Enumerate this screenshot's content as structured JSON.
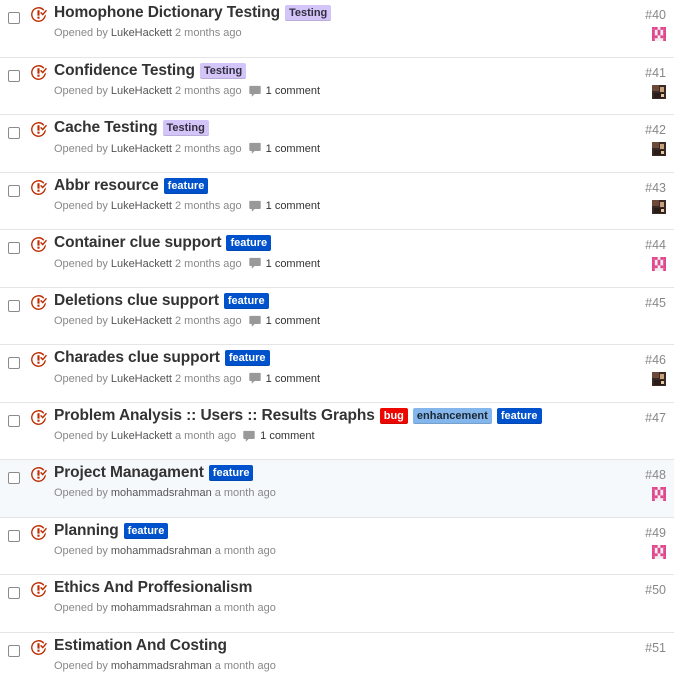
{
  "issues": [
    {
      "title": "Homophone Dictionary Testing",
      "labels": [
        {
          "text": "Testing",
          "cls": "testing"
        }
      ],
      "opened_by_prefix": "Opened by",
      "author": "LukeHackett",
      "time": "2 months ago",
      "comments": "",
      "number": "#40",
      "avatar": "identicon-pink",
      "highlighted": false
    },
    {
      "title": "Confidence Testing",
      "labels": [
        {
          "text": "Testing",
          "cls": "testing"
        }
      ],
      "opened_by_prefix": "Opened by",
      "author": "LukeHackett",
      "time": "2 months ago",
      "comments": "1 comment",
      "number": "#41",
      "avatar": "photo-dark",
      "highlighted": false
    },
    {
      "title": "Cache Testing",
      "labels": [
        {
          "text": "Testing",
          "cls": "testing"
        }
      ],
      "opened_by_prefix": "Opened by",
      "author": "LukeHackett",
      "time": "2 months ago",
      "comments": "1 comment",
      "number": "#42",
      "avatar": "photo-dark",
      "highlighted": false
    },
    {
      "title": "Abbr resource",
      "labels": [
        {
          "text": "feature",
          "cls": "feature"
        }
      ],
      "opened_by_prefix": "Opened by",
      "author": "LukeHackett",
      "time": "2 months ago",
      "comments": "1 comment",
      "number": "#43",
      "avatar": "photo-dark",
      "highlighted": false
    },
    {
      "title": "Container clue support",
      "labels": [
        {
          "text": "feature",
          "cls": "feature"
        }
      ],
      "opened_by_prefix": "Opened by",
      "author": "LukeHackett",
      "time": "2 months ago",
      "comments": "1 comment",
      "number": "#44",
      "avatar": "identicon-pink",
      "highlighted": false
    },
    {
      "title": "Deletions clue support",
      "labels": [
        {
          "text": "feature",
          "cls": "feature"
        }
      ],
      "opened_by_prefix": "Opened by",
      "author": "LukeHackett",
      "time": "2 months ago",
      "comments": "1 comment",
      "number": "#45",
      "avatar": "",
      "highlighted": false
    },
    {
      "title": "Charades clue support",
      "labels": [
        {
          "text": "feature",
          "cls": "feature"
        }
      ],
      "opened_by_prefix": "Opened by",
      "author": "LukeHackett",
      "time": "2 months ago",
      "comments": "1 comment",
      "number": "#46",
      "avatar": "photo-dark",
      "highlighted": false
    },
    {
      "title": "Problem Analysis :: Users :: Results Graphs",
      "labels": [
        {
          "text": "bug",
          "cls": "bug"
        },
        {
          "text": "enhancement",
          "cls": "enhancement"
        },
        {
          "text": "feature",
          "cls": "feature"
        }
      ],
      "opened_by_prefix": "Opened by",
      "author": "LukeHackett",
      "time": "a month ago",
      "comments": "1 comment",
      "number": "#47",
      "avatar": "",
      "highlighted": false
    },
    {
      "title": "Project Managament",
      "labels": [
        {
          "text": "feature",
          "cls": "feature"
        }
      ],
      "opened_by_prefix": "Opened by",
      "author": "mohammadsrahman",
      "time": "a month ago",
      "comments": "",
      "number": "#48",
      "avatar": "identicon-pink",
      "highlighted": true
    },
    {
      "title": "Planning",
      "labels": [
        {
          "text": "feature",
          "cls": "feature"
        }
      ],
      "opened_by_prefix": "Opened by",
      "author": "mohammadsrahman",
      "time": "a month ago",
      "comments": "",
      "number": "#49",
      "avatar": "identicon-pink",
      "highlighted": false
    },
    {
      "title": "Ethics And Proffesionalism",
      "labels": [],
      "opened_by_prefix": "Opened by",
      "author": "mohammadsrahman",
      "time": "a month ago",
      "comments": "",
      "number": "#50",
      "avatar": "",
      "highlighted": false
    },
    {
      "title": "Estimation And Costing",
      "labels": [],
      "opened_by_prefix": "Opened by",
      "author": "mohammadsrahman",
      "time": "a month ago",
      "comments": "",
      "number": "#51",
      "avatar": "",
      "highlighted": false
    }
  ],
  "colors": {
    "closed_issue_icon": "#bd2c00",
    "identicon": "#e0458d"
  }
}
